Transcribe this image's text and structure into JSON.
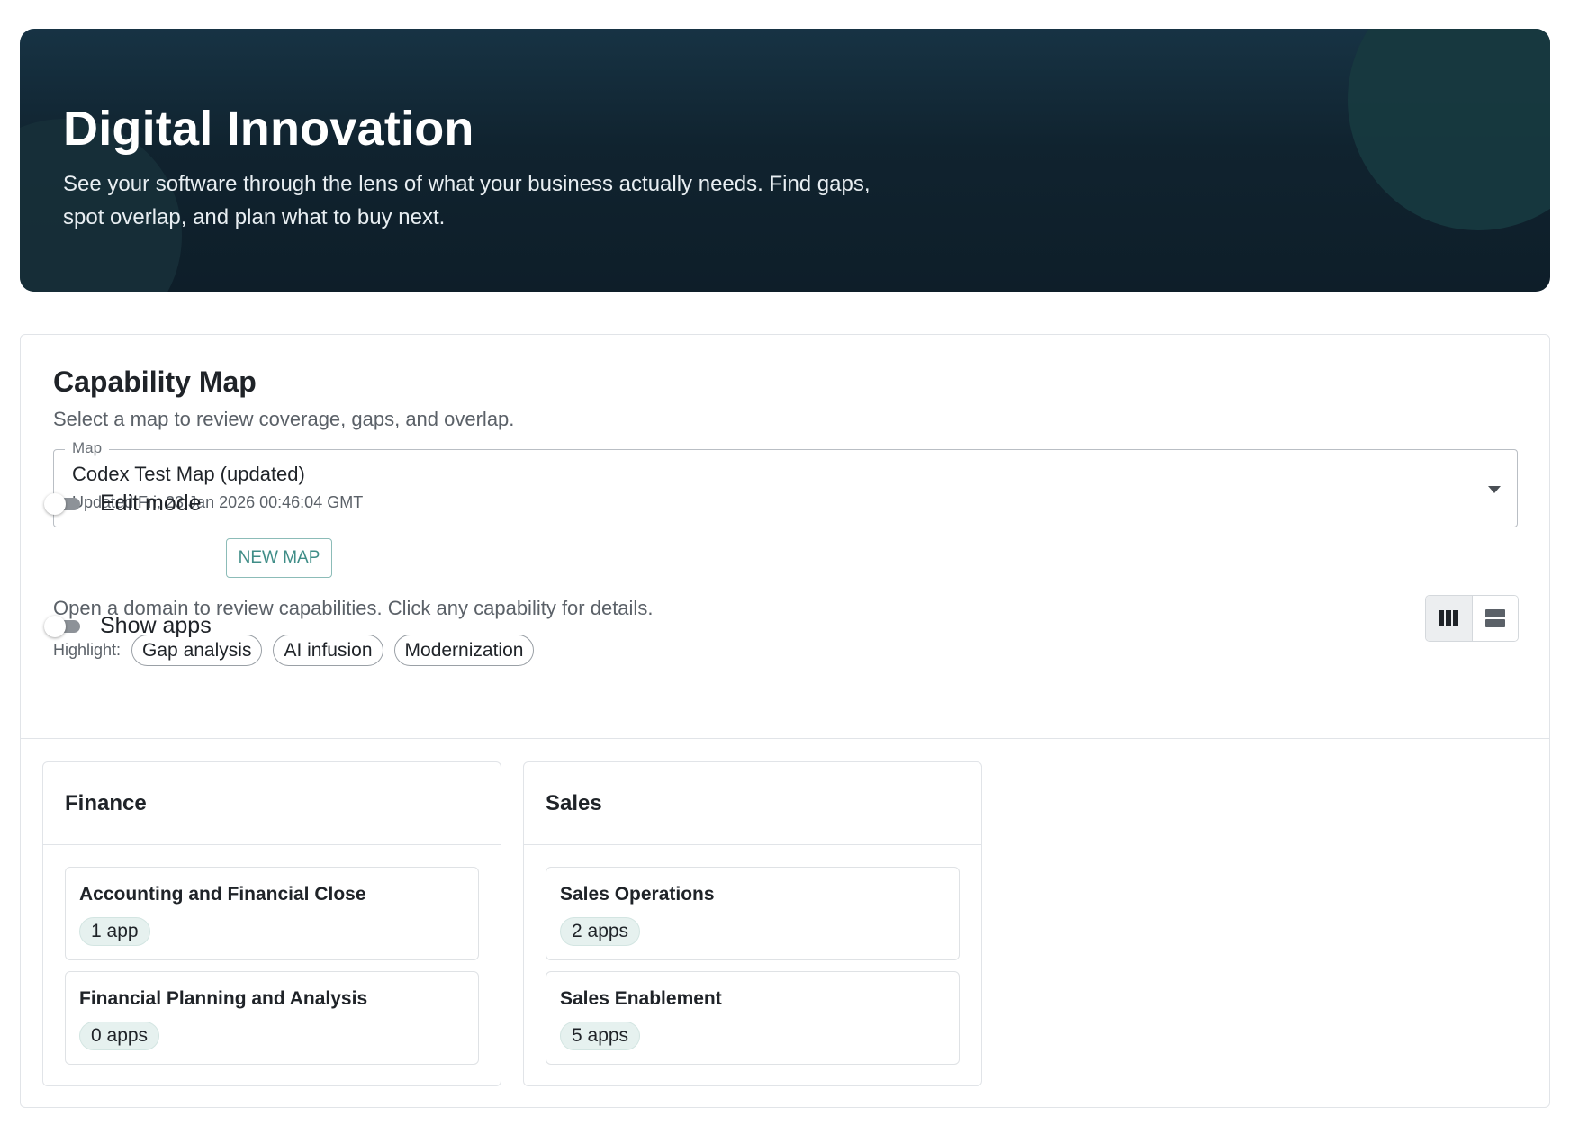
{
  "hero": {
    "title": "Digital Innovation",
    "description": "See your software through the lens of what your business actually needs. Find gaps, spot overlap, and plan what to buy next."
  },
  "capability_map": {
    "title": "Capability Map",
    "subtitle": "Select a map to review coverage, gaps, and overlap.",
    "map_select": {
      "legend": "Map",
      "value": "Codex Test Map (updated)",
      "updated": "Updated Fri, 23 Jan 2026 00:46:04 GMT"
    },
    "edit_mode_label": "Edit mode",
    "edit_mode_on": false,
    "new_map_label": "NEW MAP",
    "hint": "Open a domain to review capabilities. Click any capability for details.",
    "highlight_label": "Highlight:",
    "highlights": [
      "Gap analysis",
      "AI infusion",
      "Modernization"
    ],
    "show_apps_label": "Show apps",
    "show_apps_on": false,
    "view_modes": [
      "columns-icon",
      "rows-icon"
    ],
    "active_view": "columns"
  },
  "domains": [
    {
      "title": "Finance",
      "capabilities": [
        {
          "title": "Accounting and Financial Close",
          "apps": "1 app"
        },
        {
          "title": "Financial Planning and Analysis",
          "apps": "0 apps"
        }
      ]
    },
    {
      "title": "Sales",
      "capabilities": [
        {
          "title": "Sales Operations",
          "apps": "2 apps"
        },
        {
          "title": "Sales Enablement",
          "apps": "5 apps"
        }
      ]
    }
  ],
  "colors": {
    "hero_bg": "#10232f",
    "accent": "#3f8d87",
    "badge_bg": "#e6f1ef"
  }
}
